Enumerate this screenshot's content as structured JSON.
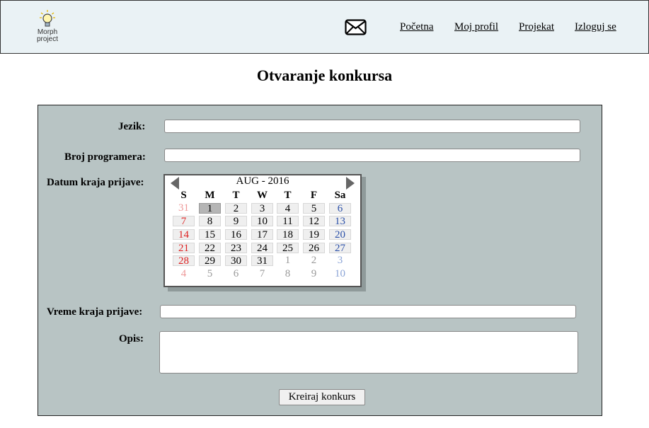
{
  "header": {
    "logo_line1": "Morph",
    "logo_line2": "project",
    "mail_icon": "envelope-icon",
    "nav": [
      "Početna",
      "Moj profil",
      "Projekat",
      "Izloguj se"
    ]
  },
  "page_title": "Otvaranje konkursa",
  "form": {
    "language_label": "Jezik:",
    "language_value": "",
    "programmers_label": "Broj programera:",
    "programmers_value": "",
    "deadline_date_label": "Datum kraja prijave:",
    "deadline_time_label": "Vreme kraja prijave:",
    "deadline_time_value": "",
    "description_label": "Opis:",
    "description_value": "",
    "submit_label": "Kreiraj konkurs"
  },
  "calendar": {
    "month_label": "AUG - 2016",
    "prev_icon": "triangle-left-icon",
    "next_icon": "triangle-right-icon",
    "weekdays": [
      "S",
      "M",
      "T",
      "W",
      "T",
      "F",
      "Sa"
    ],
    "selected_day": "1",
    "weeks": [
      [
        "31",
        "1",
        "2",
        "3",
        "4",
        "5",
        "6"
      ],
      [
        "7",
        "8",
        "9",
        "10",
        "11",
        "12",
        "13"
      ],
      [
        "14",
        "15",
        "16",
        "17",
        "18",
        "19",
        "20"
      ],
      [
        "21",
        "22",
        "23",
        "24",
        "25",
        "26",
        "27"
      ],
      [
        "28",
        "29",
        "30",
        "31",
        "1",
        "2",
        "3"
      ],
      [
        "4",
        "5",
        "6",
        "7",
        "8",
        "9",
        "10"
      ]
    ]
  },
  "colors": {
    "header_bg": "#eaf2f5",
    "panel_bg": "#b8c4c4",
    "sunday": "#dd2222",
    "saturday": "#2a4fa8",
    "selected_day_bg": "#b5b5b5"
  }
}
